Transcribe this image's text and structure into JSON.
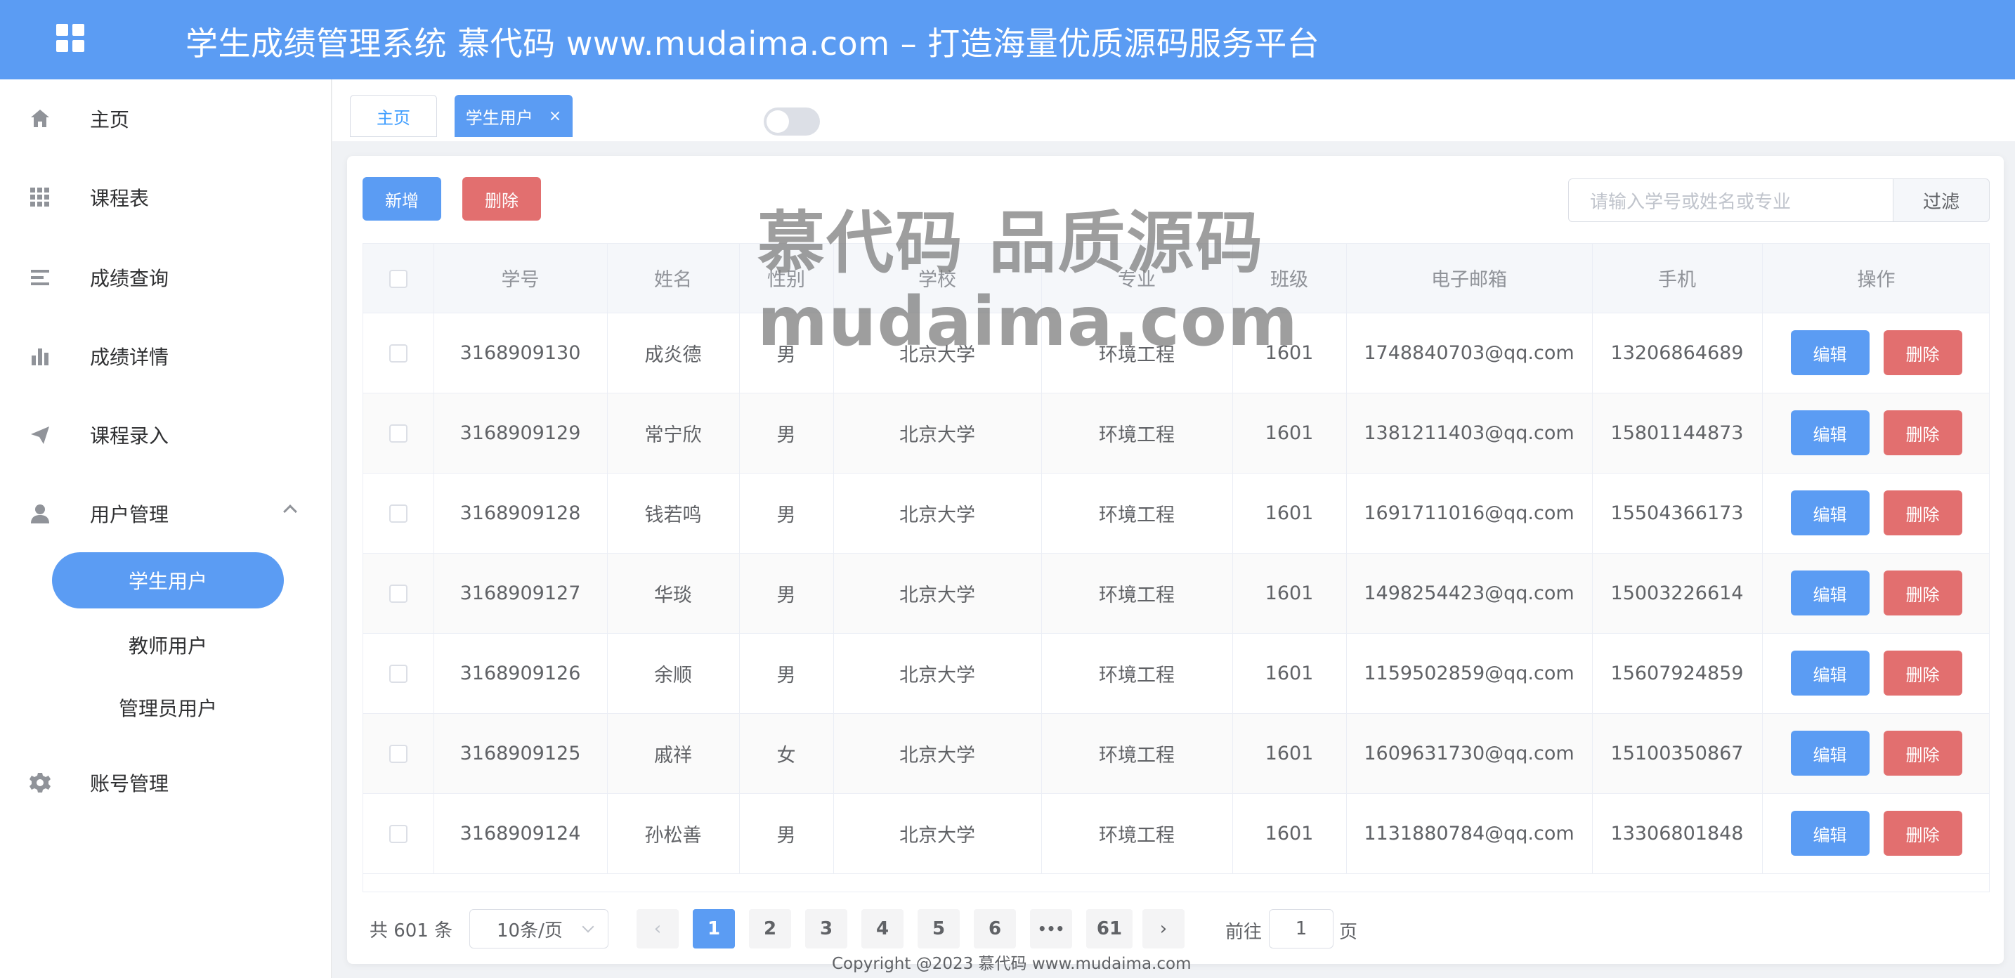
{
  "header": {
    "title": "学生成绩管理系统 慕代码 www.mudaima.com – 打造海量优质源码服务平台"
  },
  "sidebar": {
    "items": [
      {
        "label": "主页",
        "icon": "home-icon"
      },
      {
        "label": "课程表",
        "icon": "grid-icon"
      },
      {
        "label": "成绩查询",
        "icon": "list-icon"
      },
      {
        "label": "成绩详情",
        "icon": "bar-chart-icon"
      },
      {
        "label": "课程录入",
        "icon": "send-icon"
      },
      {
        "label": "用户管理",
        "icon": "user-icon"
      },
      {
        "label": "账号管理",
        "icon": "gear-icon"
      }
    ],
    "sub_items": [
      {
        "label": "学生用户",
        "active": true
      },
      {
        "label": "教师用户",
        "active": false
      },
      {
        "label": "管理员用户",
        "active": false
      }
    ]
  },
  "tabs": [
    {
      "label": "主页",
      "active": false
    },
    {
      "label": "学生用户",
      "active": true,
      "close": "×"
    }
  ],
  "toolbar": {
    "add_label": "新增",
    "delete_label": "删除",
    "search_placeholder": "请输入学号或姓名或专业",
    "filter_label": "过滤"
  },
  "table": {
    "columns": [
      "学号",
      "姓名",
      "性别",
      "学校",
      "专业",
      "班级",
      "电子邮箱",
      "手机",
      "操作"
    ],
    "edit_label": "编辑",
    "delete_label": "删除",
    "rows": [
      [
        "3168909130",
        "成炎德",
        "男",
        "北京大学",
        "环境工程",
        "1601",
        "1748840703@qq.com",
        "13206864689"
      ],
      [
        "3168909129",
        "常宁欣",
        "男",
        "北京大学",
        "环境工程",
        "1601",
        "1381211403@qq.com",
        "15801144873"
      ],
      [
        "3168909128",
        "钱若鸣",
        "男",
        "北京大学",
        "环境工程",
        "1601",
        "1691711016@qq.com",
        "15504366173"
      ],
      [
        "3168909127",
        "华琰",
        "男",
        "北京大学",
        "环境工程",
        "1601",
        "1498254423@qq.com",
        "15003226614"
      ],
      [
        "3168909126",
        "余顺",
        "男",
        "北京大学",
        "环境工程",
        "1601",
        "1159502859@qq.com",
        "15607924859"
      ],
      [
        "3168909125",
        "戚祥",
        "女",
        "北京大学",
        "环境工程",
        "1601",
        "1609631730@qq.com",
        "15100350867"
      ],
      [
        "3168909124",
        "孙松善",
        "男",
        "北京大学",
        "环境工程",
        "1601",
        "1131880784@qq.com",
        "13306801848"
      ]
    ]
  },
  "pagination": {
    "total": "共 601 条",
    "page_size": "10条/页",
    "pages": [
      "1",
      "2",
      "3",
      "4",
      "5",
      "6",
      "•••",
      "61"
    ],
    "prev": "‹",
    "next": "›",
    "goto_prefix": "前往",
    "goto_value": "1",
    "goto_suffix": "页"
  },
  "footer": {
    "copyright": "Copyright @2023 慕代码 www.mudaima.com"
  },
  "watermark": {
    "line1": "慕代码 品质源码",
    "line2": "mudaima.com"
  },
  "colors": {
    "primary": "#5b9cf3",
    "danger": "#e26f6f"
  }
}
